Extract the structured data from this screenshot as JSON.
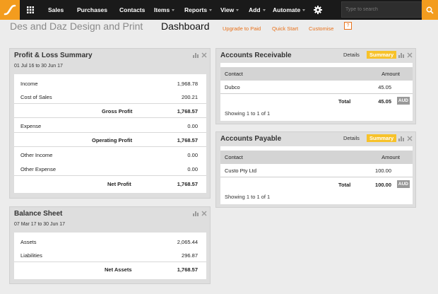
{
  "nav": {
    "items": [
      {
        "label": "Sales",
        "caret": false
      },
      {
        "label": "Purchases",
        "caret": false
      },
      {
        "label": "Contacts",
        "caret": false
      },
      {
        "label": "Items",
        "caret": true
      },
      {
        "label": "Reports",
        "caret": true
      },
      {
        "label": "View",
        "caret": true
      },
      {
        "label": "Add",
        "caret": true
      },
      {
        "label": "Automate",
        "caret": true
      }
    ],
    "search_placeholder": "Type to search",
    "colors": {
      "bar": "#1a1a1a",
      "accent": "#f39c1e"
    }
  },
  "header": {
    "org_name": "Des and Daz Design and Print",
    "page_title": "Dashboard",
    "links": [
      "Upgrade to Paid",
      "Quick Start",
      "Customise"
    ],
    "help": "?"
  },
  "pl": {
    "title": "Profit & Loss Summary",
    "period": "01 Jul 16 to 30 Jun 17",
    "rows": [
      {
        "label": "Income",
        "value": "1,968.78"
      },
      {
        "label": "Cost of Sales",
        "value": "200.21"
      },
      {
        "label": "Gross Profit",
        "value": "1,768.57"
      },
      {
        "label": "Expense",
        "value": "0.00"
      },
      {
        "label": "Operating Profit",
        "value": "1,768.57"
      },
      {
        "label": "Other Income",
        "value": "0.00"
      },
      {
        "label": "Other Expense",
        "value": "0.00"
      },
      {
        "label": "Net Profit",
        "value": "1,768.57"
      }
    ]
  },
  "bs": {
    "title": "Balance Sheet",
    "period": "07 Mar 17 to 30 Jun 17",
    "rows": [
      {
        "label": "Assets",
        "value": "2,065.44"
      },
      {
        "label": "Liabilities",
        "value": "296.87"
      },
      {
        "label": "Net Assets",
        "value": "1,768.57"
      }
    ]
  },
  "ar": {
    "title": "Accounts Receivable",
    "tab_details": "Details",
    "tab_summary": "Summary",
    "col_contact": "Contact",
    "col_amount": "Amount",
    "contact": "Dubco",
    "amount": "45.05",
    "total_label": "Total",
    "total_value": "45.05",
    "currency": "AUD",
    "showing": "Showing 1 to 1 of 1"
  },
  "ap": {
    "title": "Accounts Payable",
    "tab_details": "Details",
    "tab_summary": "Summary",
    "col_contact": "Contact",
    "col_amount": "Amount",
    "contact": "Custo Pty Ltd",
    "amount": "100.00",
    "total_label": "Total",
    "total_value": "100.00",
    "currency": "AUD",
    "showing": "Showing 1 to 1 of 1"
  }
}
